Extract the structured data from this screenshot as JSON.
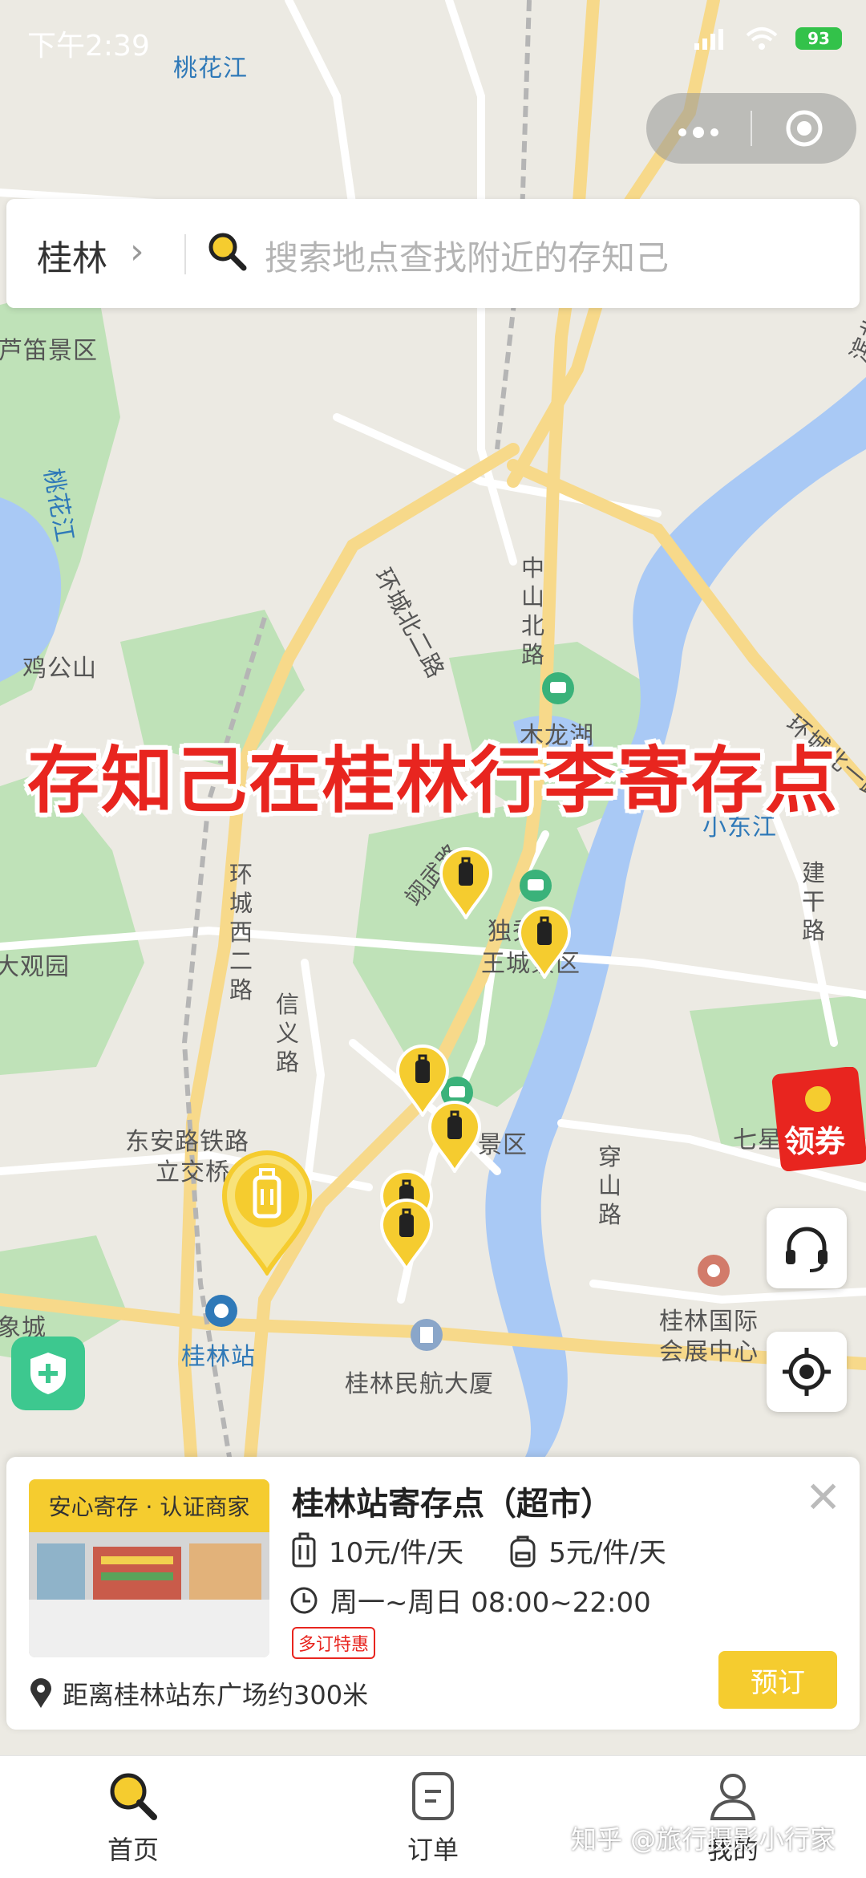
{
  "status_bar": {
    "time": "下午2:39",
    "battery": "93"
  },
  "search": {
    "city": "桂林",
    "placeholder": "搜索地点查找附近的存知己"
  },
  "headline": "存知己在桂林行李寄存点",
  "map_labels": [
    {
      "key": "taohuajiang",
      "text": "桃花江",
      "type": "water"
    },
    {
      "key": "ludi",
      "text": "芦笛景区",
      "type": "place"
    },
    {
      "key": "taohua_v",
      "text": "桃花江",
      "type": "water"
    },
    {
      "key": "jigongshan",
      "text": "鸡公山",
      "type": "place"
    },
    {
      "key": "huanchengbei",
      "text": "环城北二路",
      "type": "road"
    },
    {
      "key": "zhongshanbei",
      "text": "中山北路",
      "type": "road"
    },
    {
      "key": "binbei",
      "text": "滨北路",
      "type": "road"
    },
    {
      "key": "mulonghu",
      "text": "木龙湖",
      "type": "place"
    },
    {
      "key": "huanchengbei1",
      "text": "环城北一路",
      "type": "road"
    },
    {
      "key": "xiaodongjiang",
      "text": "小东江",
      "type": "water"
    },
    {
      "key": "jiangan",
      "text": "建干路",
      "type": "road"
    },
    {
      "key": "yiwu",
      "text": "翊武路",
      "type": "road"
    },
    {
      "key": "duxiu",
      "text": "独秀峰·",
      "type": "place"
    },
    {
      "key": "wangcheng",
      "text": "王城景区",
      "type": "place"
    },
    {
      "key": "huanchengxi",
      "text": "环城西二路",
      "type": "road"
    },
    {
      "key": "daguanyuan",
      "text": "大观园",
      "type": "place"
    },
    {
      "key": "xinyi",
      "text": "信义路",
      "type": "road"
    },
    {
      "key": "dongan1",
      "text": "东安路铁路",
      "type": "place"
    },
    {
      "key": "dongan2",
      "text": "立交桥",
      "type": "place"
    },
    {
      "key": "jingqu",
      "text": "景区",
      "type": "place"
    },
    {
      "key": "qixing",
      "text": "七星",
      "type": "place"
    },
    {
      "key": "chuanshan",
      "text": "穿山路",
      "type": "road"
    },
    {
      "key": "xiangcheng",
      "text": "象城",
      "type": "place"
    },
    {
      "key": "guilinzhan",
      "text": "桂林站",
      "type": "place-blue"
    },
    {
      "key": "minhang",
      "text": "桂林民航大厦",
      "type": "place"
    },
    {
      "key": "huizhan1",
      "text": "桂林国际",
      "type": "place"
    },
    {
      "key": "huizhan2",
      "text": "会展中心",
      "type": "place"
    }
  ],
  "coupon_label": "领券",
  "card": {
    "trust_badge": "安心寄存 · 认证商家",
    "title": "桂林站寄存点（超市）",
    "price_large": "10元/件/天",
    "price_small": "5元/件/天",
    "hours": "周一~周日 08:00~22:00",
    "promo": "多订特惠",
    "distance": "距离桂林站东广场约300米",
    "book_label": "预订"
  },
  "tabs": [
    {
      "label": "首页",
      "active": true
    },
    {
      "label": "订单",
      "active": false
    },
    {
      "label": "我的",
      "active": false
    }
  ],
  "watermark": "知乎 @旅行摄影小行家",
  "colors": {
    "accent": "#f5cc2f",
    "headline": "#e8251f",
    "park": "#bfe2b8",
    "water": "#a9c9f5",
    "road": "#f7d98a"
  }
}
